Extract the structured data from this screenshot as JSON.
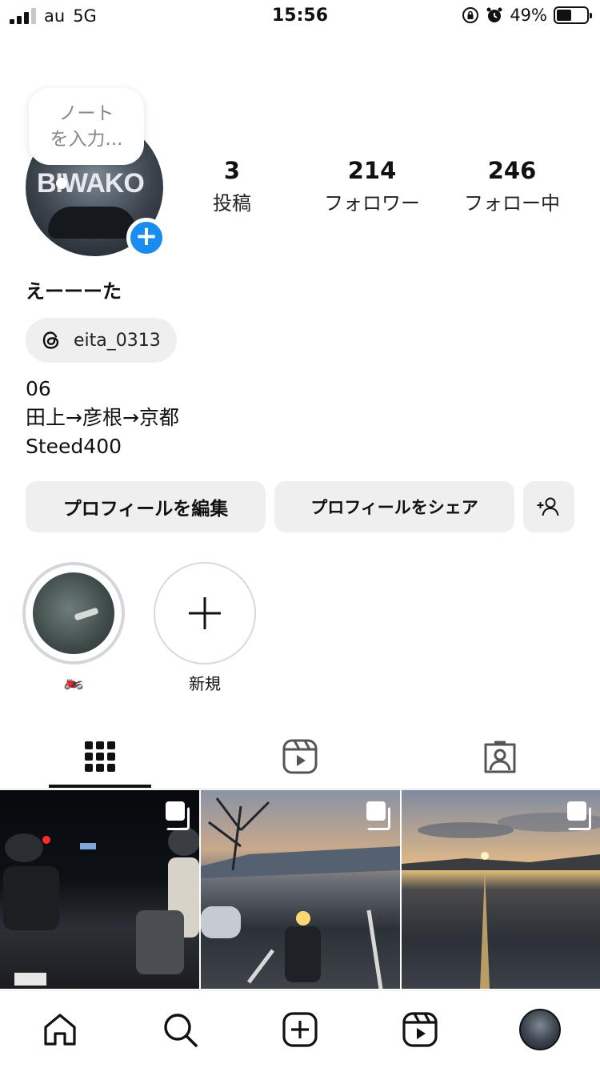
{
  "status_bar": {
    "carrier": "au",
    "network": "5G",
    "time": "15:56",
    "battery": "49%",
    "battery_level": 0.49
  },
  "profile": {
    "note_placeholder": "ノート\nを入力...",
    "avatar_sign_text": "BIWAKO",
    "stats": [
      {
        "value": "3",
        "label": "投稿"
      },
      {
        "value": "214",
        "label": "フォロワー"
      },
      {
        "value": "246",
        "label": "フォロー中"
      }
    ],
    "display_name": "えーーーた",
    "threads_handle": "eita_0313",
    "bio_lines": [
      "06",
      "田上→彦根→京都",
      "Steed400"
    ]
  },
  "buttons": {
    "edit_profile": "プロフィールを編集",
    "share_profile": "プロフィールをシェア"
  },
  "highlights": [
    {
      "label": "🏍️"
    },
    {
      "label": "新規"
    }
  ],
  "tabs": [
    "posts-grid",
    "reels",
    "tagged"
  ],
  "colors": {
    "accent": "#1a8cf0",
    "button_bg": "#efefef"
  }
}
